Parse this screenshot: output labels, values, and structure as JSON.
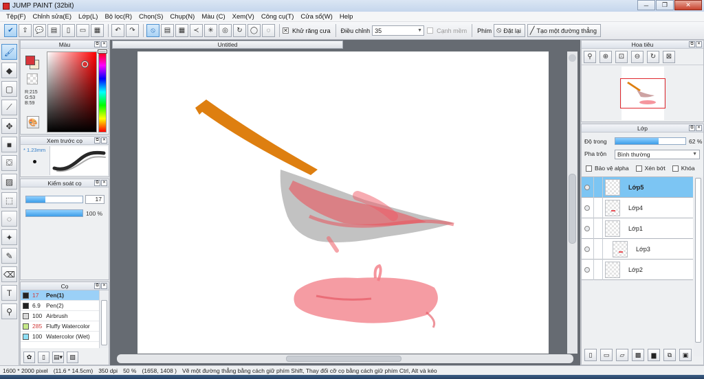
{
  "window": {
    "title": "JUMP PAINT (32bit)"
  },
  "menu": [
    "Tệp(F)",
    "Chỉnh sửa(E)",
    "Lớp(L)",
    "Bộ lọc(R)",
    "Chọn(S)",
    "Chụp(N)",
    "Màu (C)",
    "Xem(V)",
    "Công cụ(T)",
    "Cửa sổ(W)",
    "Help"
  ],
  "toolbar": {
    "antialias_label": "Khử răng cưa",
    "correction_label": "Điều chỉnh",
    "correction_value": "35",
    "soft_edge_label": "Cạnh mềm",
    "key_label": "Phím",
    "reset_label": "Đặt lại",
    "straight_line_label": "Tạo một đường thẳng"
  },
  "color_panel": {
    "title": "Màu",
    "fg_color": "#d7353b",
    "bg_color": "#f4ecd2",
    "r": "R:215",
    "g": "G:53",
    "b": "B:59"
  },
  "brush_preview": {
    "title": "Xem trước cọ",
    "size": "* 1.23mm"
  },
  "brush_control": {
    "title": "Kiểm soát cọ",
    "size_value": "17",
    "size_fraction": 0.34,
    "opacity_pct": "100 %",
    "opacity_fraction": 1.0
  },
  "brush_list": {
    "title": "Cọ",
    "items": [
      {
        "size": "17",
        "name": "Pen(1)",
        "color": "#222222",
        "selected": true
      },
      {
        "size": "6.9",
        "name": "Pen(2)",
        "color": "#222222",
        "selected": false
      },
      {
        "size": "100",
        "name": "Airbrush",
        "color": "#d9d9d9",
        "selected": false
      },
      {
        "size": "285",
        "name": "Fluffy Watercolor",
        "color": "#c5e88a",
        "selected": false
      },
      {
        "size": "100",
        "name": "Watercolor (Wet)",
        "color": "#8fe0f7",
        "selected": false
      }
    ]
  },
  "document": {
    "tab_title": "Untitled"
  },
  "navigator": {
    "title": "Hoa tiêu"
  },
  "layers": {
    "title": "Lớp",
    "opacity_label": "Độ trong",
    "opacity_value": "62 %",
    "opacity_fraction": 0.62,
    "blend_label": "Pha trộn",
    "blend_value": "Bình thường",
    "protect_alpha_label": "Bảo vệ alpha",
    "clipping_label": "Xén bớt",
    "lock_label": "Khóa",
    "items": [
      {
        "name": "Lớp5",
        "selected": true
      },
      {
        "name": "Lớp4",
        "selected": false
      },
      {
        "name": "Lớp1",
        "selected": false
      },
      {
        "name": "Lớp3",
        "selected": false
      },
      {
        "name": "Lớp2",
        "selected": false
      }
    ]
  },
  "status": {
    "size": "1600 * 2000 pixel",
    "physical": "(11.6 * 14.5cm)",
    "dpi": "350 dpi",
    "zoom": "50 %",
    "coords": "(1658, 1408 )",
    "hint": "Vẽ một đường thẳng bằng cách giữ phím Shift, Thay đổi cỡ cọ bằng cách giữ phím Ctrl, Alt và kéo"
  }
}
